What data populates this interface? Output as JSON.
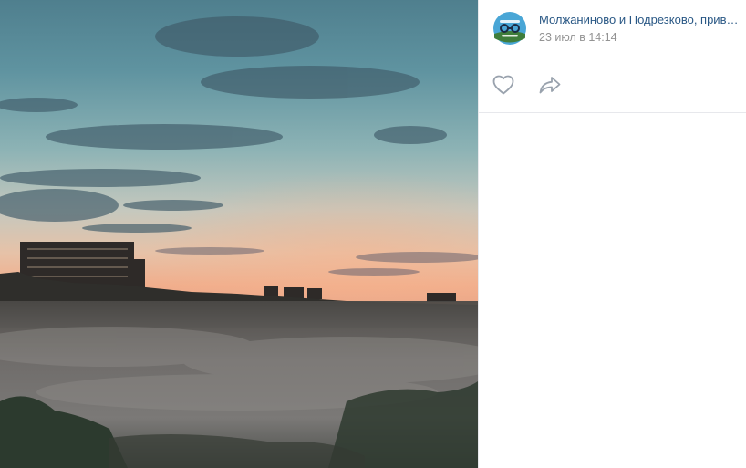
{
  "post": {
    "author": "Молжаниново и Подрезково, прив…",
    "date": "23 июл в 14:14"
  },
  "actions": {
    "like_icon": "heart-icon",
    "share_icon": "share-arrow-icon"
  },
  "colors": {
    "link": "#2a5885",
    "muted": "#939393",
    "icon": "#99a2ad",
    "divider": "#e7e8ec"
  }
}
